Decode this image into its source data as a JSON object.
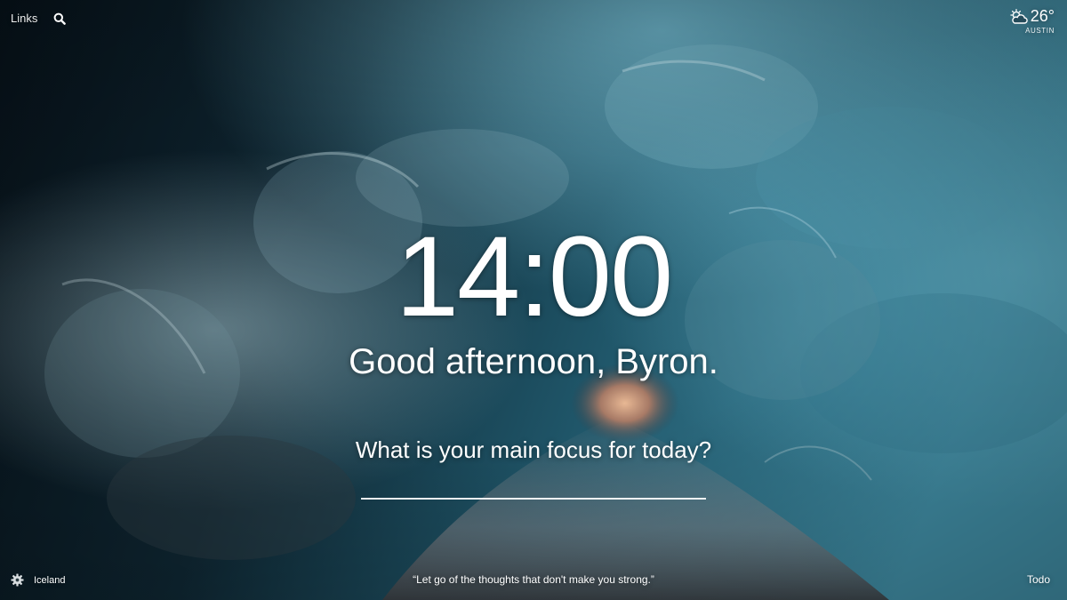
{
  "top_left": {
    "links_label": "Links",
    "search_icon": "search-icon"
  },
  "weather": {
    "icon": "partly-cloudy-icon",
    "temperature": "26°",
    "location": "AUSTIN"
  },
  "main": {
    "time": "14:00",
    "greeting": "Good afternoon, Byron.",
    "focus_question": "What is your main focus for today?",
    "focus_value": ""
  },
  "bottom": {
    "settings_icon": "gear-icon",
    "photo_location": "Iceland",
    "quote": "“Let go of the thoughts that don't make you strong.”",
    "todo_label": "Todo"
  },
  "colors": {
    "text": "#ffffff",
    "ice_deep": "#0b1a22",
    "ice_mid": "#2e6f85",
    "ice_light": "#7fb7c8",
    "tunnel_glow": "#d8a07a"
  }
}
